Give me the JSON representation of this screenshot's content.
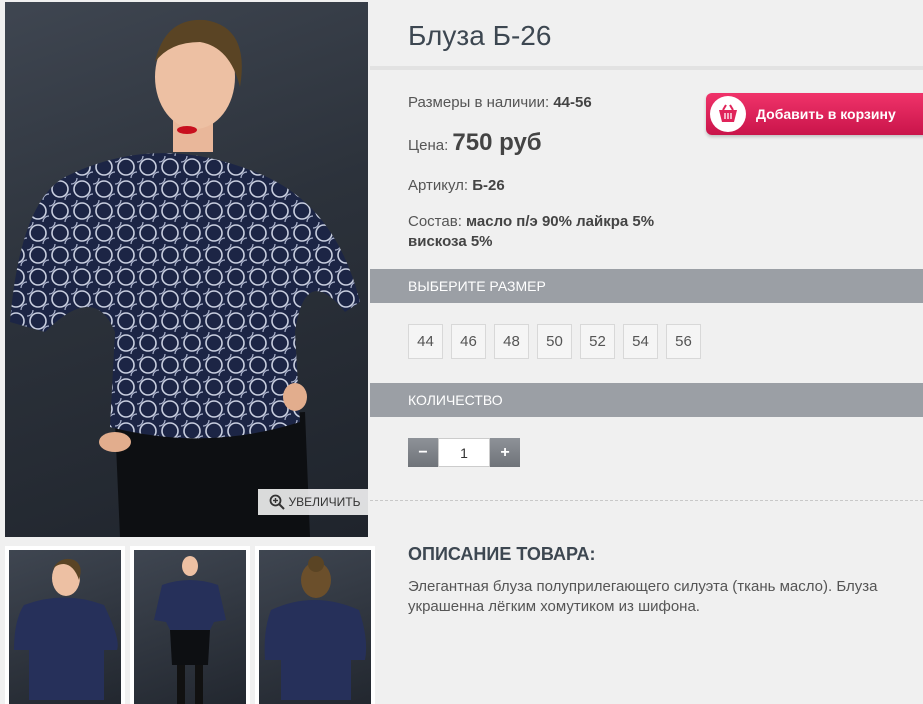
{
  "product": {
    "title": "Блуза Б-26",
    "sizes_available_label": "Размеры в наличии:",
    "sizes_available_value": "44-56",
    "price_label": "Цена:",
    "price_value": "750 руб",
    "article_label": "Артикул:",
    "article_value": "Б-26",
    "composition_label": "Состав:",
    "composition_value": "масло п/э 90% лайкра 5% вискоза 5%"
  },
  "cart_button": {
    "label": "Добавить в корзину",
    "icon": "basket-icon"
  },
  "gallery": {
    "zoom_label": "УВЕЛИЧИТЬ",
    "zoom_icon": "magnifier-plus-icon",
    "thumbnail_count": 3
  },
  "size_section": {
    "title": "ВЫБЕРИТЕ РАЗМЕР",
    "options": [
      "44",
      "46",
      "48",
      "50",
      "52",
      "54",
      "56"
    ]
  },
  "quantity_section": {
    "title": "КОЛИЧЕСТВО",
    "minus": "−",
    "value": "1",
    "plus": "+"
  },
  "description": {
    "title": "ОПИСАНИЕ ТОВАРА:",
    "text": "Элегантная блуза полуприлегающего силуэта (ткань масло). Блуза украшенна лёгким хомутиком из шифона."
  },
  "colors": {
    "cart_button": "#e0245a",
    "section_bar": "#9b9fa5",
    "title": "#3d4751"
  }
}
